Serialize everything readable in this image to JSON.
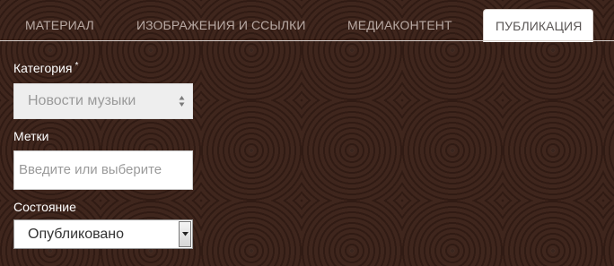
{
  "tabs": [
    {
      "label": "МАТЕРИАЛ",
      "active": false
    },
    {
      "label": "ИЗОБРАЖЕНИЯ И ССЫЛКИ",
      "active": false
    },
    {
      "label": "МЕДИАКОНТЕНТ",
      "active": false
    },
    {
      "label": "ПУБЛИКАЦИЯ",
      "active": true
    }
  ],
  "form": {
    "category": {
      "label": "Категория",
      "required_mark": "*",
      "value": "Новости музыки"
    },
    "tags": {
      "label": "Метки",
      "placeholder": "Введите или выберите"
    },
    "state": {
      "label": "Состояние",
      "value": "Опубликовано"
    }
  },
  "colors": {
    "background": "#3a2118",
    "active_tab_bg": "#ffffff",
    "inactive_tab_text": "#b9aaa4"
  }
}
